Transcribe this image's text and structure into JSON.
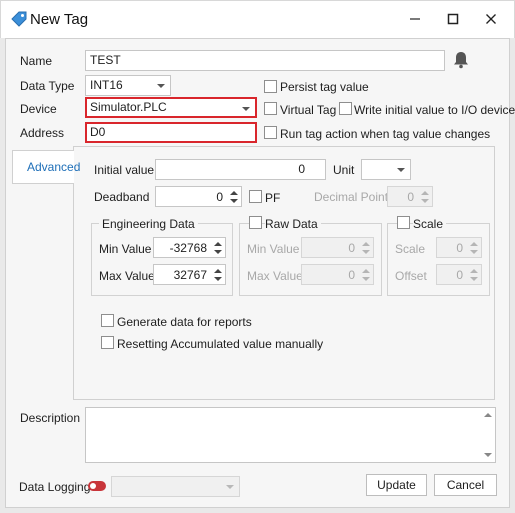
{
  "window": {
    "title": "New Tag",
    "icon": "tag-icon",
    "controls": [
      "minimize-icon",
      "maximize-icon",
      "close-icon"
    ]
  },
  "fields": {
    "name_label": "Name",
    "name_value": "TEST",
    "data_type_label": "Data Type",
    "data_type_value": "INT16",
    "device_label": "Device",
    "device_value": "Simulator.PLC",
    "address_label": "Address",
    "address_value": "D0"
  },
  "options": {
    "persist": "Persist tag value",
    "virtual": "Virtual Tag",
    "write_initial": "Write initial value to I/O device",
    "run_action": "Run tag action when tag value changes"
  },
  "tabs": {
    "advanced": "Advanced"
  },
  "advanced": {
    "initial_value_label": "Initial value",
    "initial_value": "0",
    "unit_label": "Unit",
    "unit_value": "",
    "deadband_label": "Deadband",
    "deadband_value": "0",
    "pf_label": "PF",
    "decimal_point_label": "Decimal Point",
    "decimal_point_value": "0",
    "engineering": {
      "title": "Engineering Data",
      "min_label": "Min Value",
      "min_value": "-32768",
      "max_label": "Max Value",
      "max_value": "32767"
    },
    "raw": {
      "title": "Raw Data",
      "min_label": "Min Value",
      "min_value": "0",
      "max_label": "Max Value",
      "max_value": "0"
    },
    "scale": {
      "title": "Scale",
      "scale_label": "Scale",
      "scale_value": "0",
      "offset_label": "Offset",
      "offset_value": "0"
    },
    "generate_reports": "Generate data for reports",
    "resetting_accumulated": "Resetting Accumulated value manually"
  },
  "description_label": "Description",
  "data_logging_label": "Data Logging",
  "buttons": {
    "update": "Update",
    "cancel": "Cancel"
  },
  "colors": {
    "highlight": "#d9262c",
    "accent": "#1e6fb8",
    "toggle_off": "#c8353a"
  }
}
